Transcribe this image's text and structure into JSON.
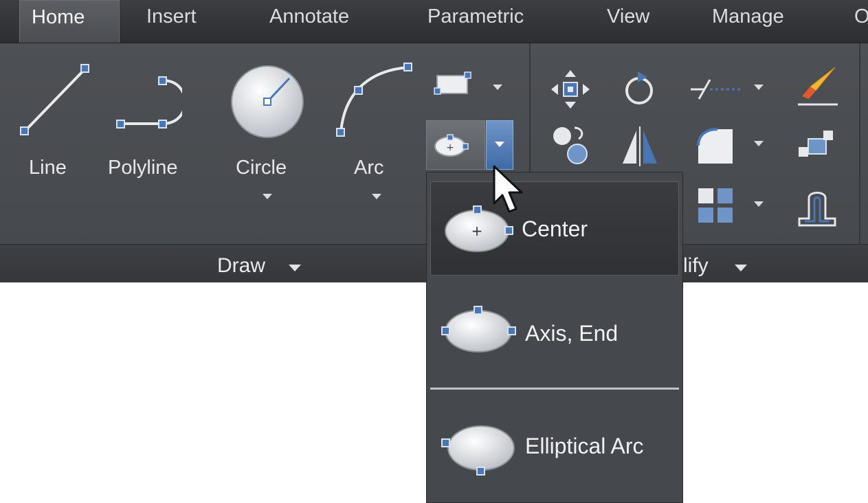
{
  "tabs": [
    {
      "label": "Home",
      "active": true
    },
    {
      "label": "Insert"
    },
    {
      "label": "Annotate"
    },
    {
      "label": "Parametric"
    },
    {
      "label": "View"
    },
    {
      "label": "Manage"
    },
    {
      "label": "O"
    }
  ],
  "draw_panel": {
    "tools": [
      {
        "label": "Line",
        "icon": "line-icon"
      },
      {
        "label": "Polyline",
        "icon": "polyline-icon"
      },
      {
        "label": "Circle",
        "icon": "circle-icon"
      },
      {
        "label": "Arc",
        "icon": "arc-icon"
      }
    ],
    "footer_label": "Draw"
  },
  "modify_panel": {
    "footer_label": "Modify",
    "footer_visible_text": "lify",
    "icons": [
      "move-icon",
      "rotate-icon",
      "trim-icon",
      "erase-icon",
      "copy-icon",
      "mirror-icon",
      "fillet-icon",
      "explode-icon",
      "array-icon",
      "offset-icon"
    ]
  },
  "ellipse_menu": {
    "items": [
      {
        "label": "Center",
        "icon": "ellipse-center-icon",
        "highlighted": true
      },
      {
        "label": "Axis, End",
        "icon": "ellipse-axis-end-icon"
      },
      {
        "label": "Elliptical Arc",
        "icon": "elliptical-arc-icon"
      }
    ]
  },
  "colors": {
    "ribbon_bg": "#4b4e52",
    "tab_bar_bg": "#35373a",
    "accent_blue": "#4a76b3",
    "grip_blue": "#3b66b0"
  }
}
